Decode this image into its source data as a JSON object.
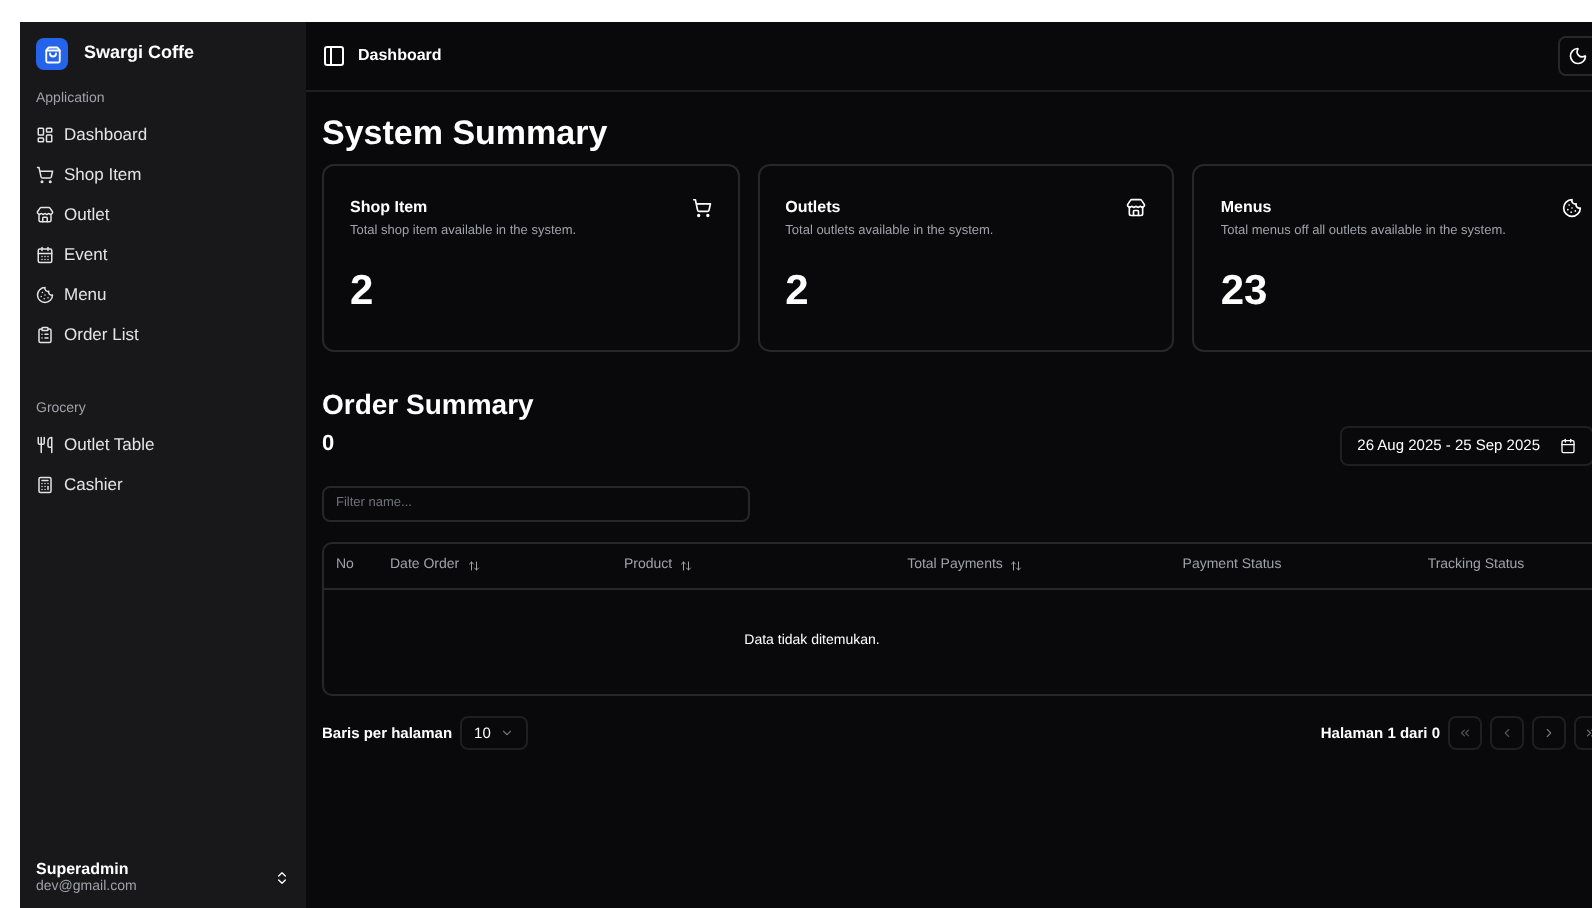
{
  "app": {
    "name": "Swargi Coffe"
  },
  "sidebar": {
    "groups": [
      {
        "label": "Application",
        "items": [
          {
            "label": "Dashboard"
          },
          {
            "label": "Shop Item"
          },
          {
            "label": "Outlet"
          },
          {
            "label": "Event"
          },
          {
            "label": "Menu"
          },
          {
            "label": "Order List"
          }
        ]
      },
      {
        "label": "Grocery",
        "items": [
          {
            "label": "Outlet Table"
          },
          {
            "label": "Cashier"
          }
        ]
      }
    ],
    "user": {
      "name": "Superadmin",
      "email": "dev@gmail.com"
    }
  },
  "header": {
    "title": "Dashboard"
  },
  "system_summary": {
    "title": "System Summary",
    "cards": [
      {
        "title": "Shop Item",
        "description": "Total shop item available in the system.",
        "value": "2"
      },
      {
        "title": "Outlets",
        "description": "Total outlets available in the system.",
        "value": "2"
      },
      {
        "title": "Menus",
        "description": "Total menus off all outlets available in the system.",
        "value": "23"
      }
    ]
  },
  "order_summary": {
    "title": "Order Summary",
    "count": "0",
    "date_range": "26 Aug 2025 - 25 Sep 2025",
    "filter": {
      "placeholder": "Filter name..."
    },
    "table": {
      "columns": [
        {
          "label": "No",
          "sortable": false
        },
        {
          "label": "Date Order",
          "sortable": true
        },
        {
          "label": "Product",
          "sortable": true
        },
        {
          "label": "Total Payments",
          "sortable": true
        },
        {
          "label": "Payment Status",
          "sortable": false
        },
        {
          "label": "Tracking Status",
          "sortable": false
        }
      ],
      "empty_message": "Data tidak ditemukan."
    },
    "pagination": {
      "rows_label": "Baris per halaman",
      "rows_value": "10",
      "page_label": "Halaman 1 dari 0"
    }
  }
}
